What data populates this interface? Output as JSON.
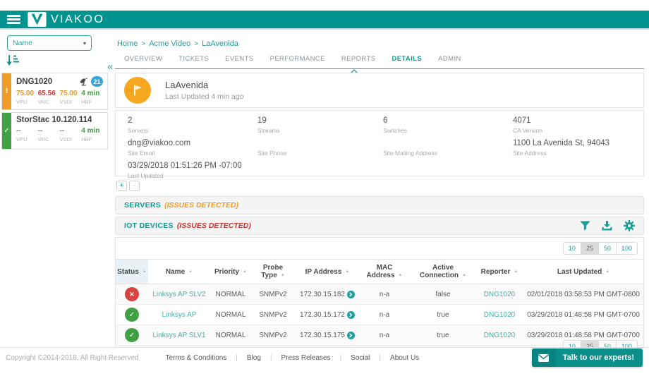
{
  "colors": {
    "header_teal": "#009490",
    "link_teal": "#2fa49c",
    "table_link_teal": "#41b0a8",
    "orange": "#f5a81f",
    "red": "#cb3431",
    "green": "#3fa142",
    "badge_blue": "#38a3dc"
  },
  "icons": {
    "check_glyph": "✓",
    "x_glyph": "×",
    "warn_glyph": "!",
    "collapse_glyph": "«",
    "dropdown_caret": "▾",
    "sort_arrow": "▲"
  },
  "header": {
    "logo": "VIAKOO"
  },
  "sidebar": {
    "sort_field": {
      "value": "Name"
    },
    "items": [
      {
        "name": "DNG1020",
        "badge": "21",
        "metrics": [
          {
            "value": "75.00",
            "label": "VPU"
          },
          {
            "value": "65.56",
            "label": "VRC"
          },
          {
            "value": "75.00",
            "label": "VSDI"
          },
          {
            "value": "4 min",
            "label": "HBF"
          }
        ]
      },
      {
        "name": "StorStac 10.120.114",
        "metrics": [
          {
            "value": "--",
            "label": "VPU"
          },
          {
            "value": "--",
            "label": "VRC"
          },
          {
            "value": "--",
            "label": "VSDI"
          },
          {
            "value": "4 min",
            "label": "HBF"
          }
        ]
      }
    ]
  },
  "breadcrumb": {
    "items": [
      "Home",
      "Acme Video",
      "LaAvenida"
    ],
    "separator": ">"
  },
  "tabs": {
    "items": [
      "OVERVIEW",
      "TICKETS",
      "EVENTS",
      "PERFORMANCE",
      "REPORTS",
      "DETAILS",
      "ADMIN"
    ],
    "active": "DETAILS"
  },
  "site": {
    "name": "LaAvenida",
    "last_updated": "Last Updated 4 min ago"
  },
  "details": {
    "cells": [
      {
        "value": "2",
        "label": "Servers"
      },
      {
        "value": "19",
        "label": "Streams"
      },
      {
        "value": "6",
        "label": "Switches"
      },
      {
        "value": "4071",
        "label": "CA Version"
      },
      {
        "value": "dng@viakoo.com",
        "label": "Site Email"
      },
      {
        "value": "",
        "label": "Site Phone"
      },
      {
        "value": "",
        "label": "Site Mailing Address"
      },
      {
        "value": "1100 La Avenida St, 94043",
        "label": "Site Address"
      },
      {
        "value": "03/29/2018 01:51:26 PM -07:00",
        "label": "Last Updated"
      }
    ]
  },
  "zoom_controls": {
    "plus": "+",
    "minus": "-"
  },
  "sections": {
    "servers": {
      "title": "SERVERS",
      "issues": "(ISSUES DETECTED)"
    },
    "iot": {
      "title": "IOT DEVICES",
      "issues": "(ISSUES DETECTED)"
    }
  },
  "pagination": {
    "options": [
      "10",
      "25",
      "50",
      "100"
    ],
    "selected": "25"
  },
  "table": {
    "columns": [
      "Status",
      "Name",
      "Priority",
      "Probe Type",
      "IP Address",
      "MAC Address",
      "Active Connection",
      "Reporter",
      "Last Updated"
    ],
    "rows": [
      {
        "status": "error",
        "name": "Linksys AP SLV2",
        "priority": "NORMAL",
        "probe_type": "SNMPv2",
        "ip": "172.30.15.182",
        "mac": "n-a",
        "active": "false",
        "reporter": "DNG1020",
        "last_updated": "02/01/2018 03:58:53 PM GMT-0800"
      },
      {
        "status": "ok",
        "name": "Linksys AP",
        "priority": "NORMAL",
        "probe_type": "SNMPv2",
        "ip": "172.30.15.172",
        "mac": "n-a",
        "active": "true",
        "reporter": "DNG1020",
        "last_updated": "03/29/2018 01:48:58 PM GMT-0700"
      },
      {
        "status": "ok",
        "name": "Linksys AP SLV1",
        "priority": "NORMAL",
        "probe_type": "SNMPv2",
        "ip": "172.30.15.175",
        "mac": "n-a",
        "active": "true",
        "reporter": "DNG1020",
        "last_updated": "03/29/2018 01:48:58 PM GMT-0700"
      }
    ]
  },
  "footer": {
    "copyright": "Copyright ©2014-2018, All Right Reserved",
    "links": [
      "Terms & Conditions",
      "Blog",
      "Press Releases",
      "Social",
      "About Us"
    ],
    "separator": "|"
  },
  "talk_button": {
    "label": "Talk to our experts!"
  }
}
